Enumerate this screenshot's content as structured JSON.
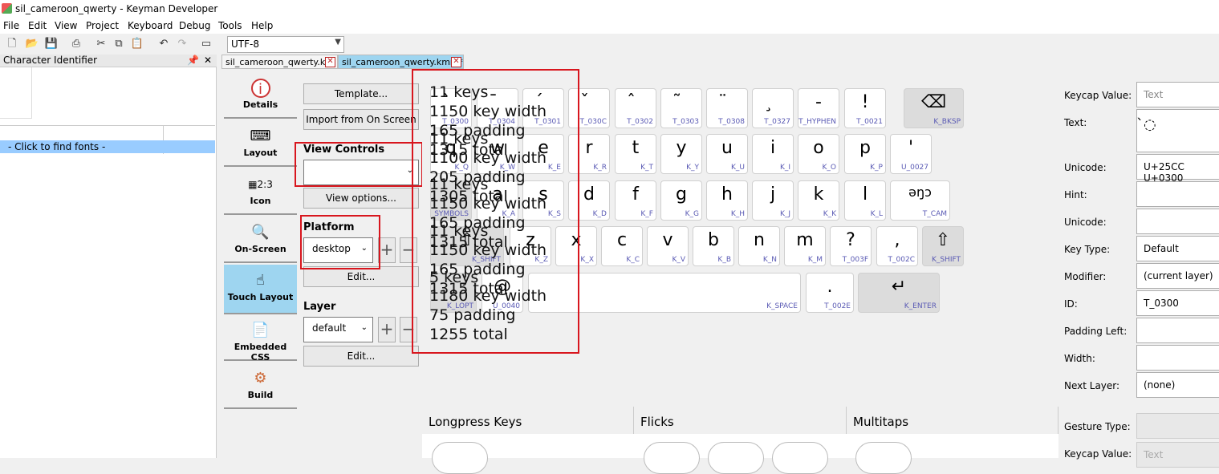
{
  "titlebar": {
    "title": "sil_cameroon_qwerty - Keyman Developer"
  },
  "menu": [
    "File",
    "Edit",
    "View",
    "Project",
    "Keyboard",
    "Debug",
    "Tools",
    "Help"
  ],
  "encoding": "UTF-8",
  "left_panel": {
    "title": "Character Identifier",
    "find_fonts": "- Click to find fonts -"
  },
  "tabs": [
    {
      "label": "sil_cameroon_qwerty.kpj"
    },
    {
      "label": "sil_cameroon_qwerty.kmn *"
    }
  ],
  "nav": [
    {
      "label": "Details",
      "icon": "info-icon"
    },
    {
      "label": "Layout",
      "icon": "keyboard-icon"
    },
    {
      "label": "Icon",
      "icon": "icon-editor-icon"
    },
    {
      "label": "On-Screen",
      "icon": "on-screen-keyboard-icon"
    },
    {
      "label": "Touch Layout",
      "icon": "touch-layout-icon"
    },
    {
      "label": "Embedded CSS",
      "icon": "css-document-icon"
    },
    {
      "label": "Build",
      "icon": "gear-icon"
    }
  ],
  "options": {
    "template": "Template...",
    "import": "Import from On Screen",
    "view_controls": "View Controls",
    "view_controls_value": "",
    "view_options": "View options...",
    "platform": "Platform",
    "platform_value": "desktop",
    "edit": "Edit...",
    "layer": "Layer",
    "layer_value": "default",
    "edit2": "Edit..."
  },
  "keys": {
    "r1": [
      {
        "m": "̀",
        "id": "T_0300"
      },
      {
        "m": "̄",
        "id": "T_0304"
      },
      {
        "m": "́",
        "id": "T_0301"
      },
      {
        "m": "̌",
        "id": "T_030C"
      },
      {
        "m": "̂",
        "id": "T_0302"
      },
      {
        "m": "̃",
        "id": "T_0303"
      },
      {
        "m": "̈",
        "id": "T_0308"
      },
      {
        "m": "̧",
        "id": "T_0327"
      },
      {
        "m": "-",
        "id": "T_HYPHEN"
      },
      {
        "m": "!",
        "id": "T_0021"
      },
      {
        "m": "⌫",
        "id": "K_BKSP"
      }
    ],
    "r2": [
      {
        "m": "q",
        "id": "K_Q"
      },
      {
        "m": "w",
        "id": "K_W"
      },
      {
        "m": "e",
        "id": "K_E"
      },
      {
        "m": "r",
        "id": "K_R"
      },
      {
        "m": "t",
        "id": "K_T"
      },
      {
        "m": "y",
        "id": "K_Y"
      },
      {
        "m": "u",
        "id": "K_U"
      },
      {
        "m": "i",
        "id": "K_I"
      },
      {
        "m": "o",
        "id": "K_O"
      },
      {
        "m": "p",
        "id": "K_P"
      },
      {
        "m": "'",
        "id": "U_0027"
      }
    ],
    "r3": [
      {
        "m": "",
        "id": "SYMBOLS"
      },
      {
        "m": "a",
        "id": "K_A"
      },
      {
        "m": "s",
        "id": "K_S"
      },
      {
        "m": "d",
        "id": "K_D"
      },
      {
        "m": "f",
        "id": "K_F"
      },
      {
        "m": "g",
        "id": "K_G"
      },
      {
        "m": "h",
        "id": "K_H"
      },
      {
        "m": "j",
        "id": "K_J"
      },
      {
        "m": "k",
        "id": "K_K"
      },
      {
        "m": "l",
        "id": "K_L"
      },
      {
        "m": "əŋɔ",
        "id": "T_CAM"
      }
    ],
    "r4": [
      {
        "m": "⇧",
        "id": "K_SHIFT"
      },
      {
        "m": "z",
        "id": "K_Z"
      },
      {
        "m": "x",
        "id": "K_X"
      },
      {
        "m": "c",
        "id": "K_C"
      },
      {
        "m": "v",
        "id": "K_V"
      },
      {
        "m": "b",
        "id": "K_B"
      },
      {
        "m": "n",
        "id": "K_N"
      },
      {
        "m": "m",
        "id": "K_M"
      },
      {
        "m": "?",
        "id": "T_003F"
      },
      {
        "m": ",",
        "id": "T_002C"
      },
      {
        "m": "⇧",
        "id": "K_SHIFT"
      }
    ],
    "r5": [
      {
        "m": "",
        "id": "K_LOPT"
      },
      {
        "m": "@",
        "id": "U_0040"
      },
      {
        "m": "",
        "id": "K_SPACE"
      },
      {
        "m": ".",
        "id": "T_002E"
      },
      {
        "m": "↵",
        "id": "K_ENTER"
      }
    ]
  },
  "overlay": [
    "11 keys",
    "1150 key width",
    "165 padding",
    "1315 total",
    "11 keys",
    "1100 key width",
    "205 padding",
    "1305 total",
    "11 keys",
    "1150 key width",
    "165 padding",
    "1315 total",
    "11 keys",
    "1150 key width",
    "165 padding",
    "1315 total",
    "5 keys",
    "1180 key width",
    "75 padding",
    "1255 total"
  ],
  "props": {
    "keycap_label": "Keycap Value:",
    "keycap_placeholder": "Text",
    "text_label": "Text:",
    "text_value": "̀◌",
    "unicode_label": "Unicode:",
    "unicode_value": "U+25CC U+0300",
    "hint_label": "Hint:",
    "unicode2_label": "Unicode:",
    "keytype_label": "Key Type:",
    "keytype_value": "Default",
    "modifier_label": "Modifier:",
    "modifier_value": "(current layer)",
    "id_label": "ID:",
    "id_value": "T_0300",
    "padleft_label": "Padding Left:",
    "width_label": "Width:",
    "nextlayer_label": "Next Layer:",
    "nextlayer_value": "(none)"
  },
  "bottom": {
    "longpress": "Longpress Keys",
    "flicks": "Flicks",
    "multitaps": "Multitaps",
    "gesture_label": "Gesture Type:",
    "keycap_label": "Keycap Value:",
    "keycap_placeholder": "Text"
  }
}
